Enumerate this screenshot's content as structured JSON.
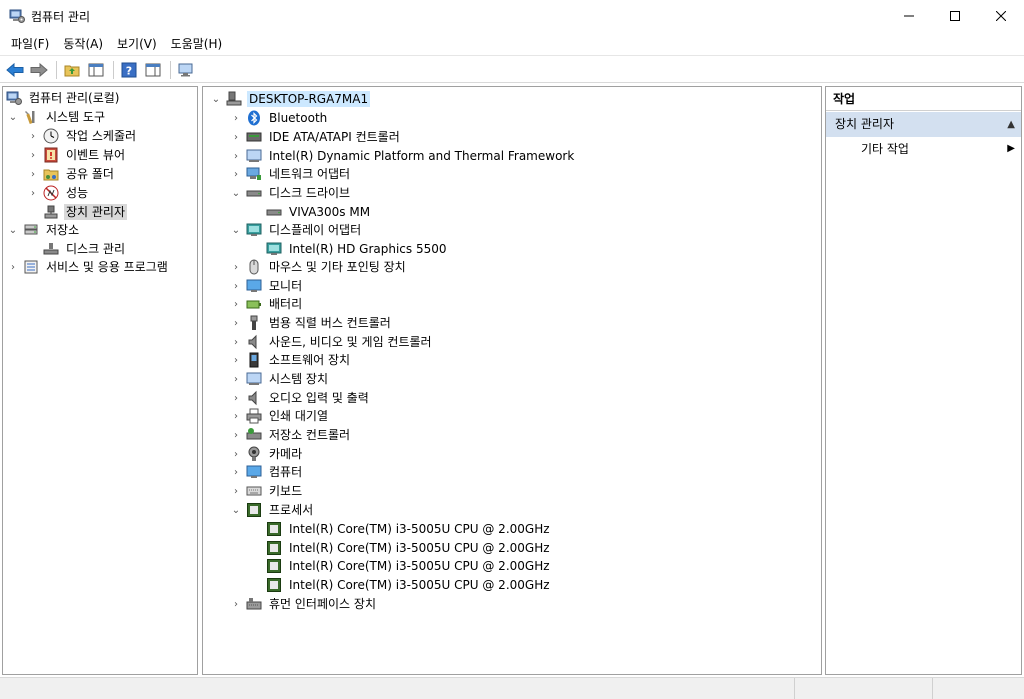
{
  "window": {
    "title": "컴퓨터 관리",
    "icon": "computer-management-icon",
    "controls": [
      "minimize-icon",
      "maximize-icon",
      "close-icon"
    ]
  },
  "menu": [
    "파일(F)",
    "동작(A)",
    "보기(V)",
    "도움말(H)"
  ],
  "toolbar": [
    "back-arrow-icon",
    "forward-arrow-icon",
    "up-folder-icon",
    "show-hide-tree-icon",
    "help-icon",
    "properties-icon",
    "monitor-icon"
  ],
  "left_tree": [
    {
      "label": "컴퓨터 관리(로컬)",
      "icon": "computer-management-icon",
      "expander": "none"
    },
    {
      "label": "시스템 도구",
      "icon": "tools-icon",
      "expander": "expanded"
    },
    {
      "label": "작업 스케줄러",
      "icon": "clock-icon",
      "expander": "collapsed"
    },
    {
      "label": "이벤트 뷰어",
      "icon": "event-viewer-icon",
      "expander": "collapsed"
    },
    {
      "label": "공유 폴더",
      "icon": "shared-folder-icon",
      "expander": "collapsed"
    },
    {
      "label": "성능",
      "icon": "performance-icon",
      "expander": "collapsed"
    },
    {
      "label": "장치 관리자",
      "icon": "device-manager-icon",
      "expander": "none"
    },
    {
      "label": "저장소",
      "icon": "storage-icon",
      "expander": "expanded"
    },
    {
      "label": "디스크 관리",
      "icon": "disk-management-icon",
      "expander": "none"
    },
    {
      "label": "서비스 및 응용 프로그램",
      "icon": "services-icon",
      "expander": "collapsed"
    }
  ],
  "device_tree": [
    {
      "label": "DESKTOP-RGA7MA1",
      "icon": "computer-icon",
      "expander": "expanded"
    },
    {
      "label": "Bluetooth",
      "icon": "bluetooth-icon",
      "expander": "collapsed"
    },
    {
      "label": "IDE ATA/ATAPI 컨트롤러",
      "icon": "ide-controller-icon",
      "expander": "collapsed"
    },
    {
      "label": "Intel(R) Dynamic Platform and Thermal Framework",
      "icon": "system-device-icon",
      "expander": "collapsed"
    },
    {
      "label": "네트워크 어댑터",
      "icon": "network-adapter-icon",
      "expander": "collapsed"
    },
    {
      "label": "디스크 드라이브",
      "icon": "disk-drive-icon",
      "expander": "expanded"
    },
    {
      "label": "VIVA300s MM",
      "icon": "disk-drive-icon",
      "expander": "none"
    },
    {
      "label": "디스플레이 어댑터",
      "icon": "display-adapter-icon",
      "expander": "expanded"
    },
    {
      "label": "Intel(R) HD Graphics 5500",
      "icon": "display-adapter-icon",
      "expander": "none"
    },
    {
      "label": "마우스 및 기타 포인팅 장치",
      "icon": "mouse-icon",
      "expander": "collapsed"
    },
    {
      "label": "모니터",
      "icon": "monitor-icon",
      "expander": "collapsed"
    },
    {
      "label": "배터리",
      "icon": "battery-icon",
      "expander": "collapsed"
    },
    {
      "label": "범용 직렬 버스 컨트롤러",
      "icon": "usb-icon",
      "expander": "collapsed"
    },
    {
      "label": "사운드, 비디오 및 게임 컨트롤러",
      "icon": "speaker-icon",
      "expander": "collapsed"
    },
    {
      "label": "소프트웨어 장치",
      "icon": "software-device-icon",
      "expander": "collapsed"
    },
    {
      "label": "시스템 장치",
      "icon": "system-device-icon",
      "expander": "collapsed"
    },
    {
      "label": "오디오 입력 및 출력",
      "icon": "speaker-icon",
      "expander": "collapsed"
    },
    {
      "label": "인쇄 대기열",
      "icon": "printer-icon",
      "expander": "collapsed"
    },
    {
      "label": "저장소 컨트롤러",
      "icon": "storage-controller-icon",
      "expander": "collapsed"
    },
    {
      "label": "카메라",
      "icon": "camera-icon",
      "expander": "collapsed"
    },
    {
      "label": "컴퓨터",
      "icon": "monitor-icon",
      "expander": "collapsed"
    },
    {
      "label": "키보드",
      "icon": "keyboard-icon",
      "expander": "collapsed"
    },
    {
      "label": "프로세서",
      "icon": "processor-icon",
      "expander": "expanded"
    },
    {
      "label": "Intel(R) Core(TM) i3-5005U CPU @ 2.00GHz",
      "icon": "processor-icon",
      "expander": "none"
    },
    {
      "label": "Intel(R) Core(TM) i3-5005U CPU @ 2.00GHz",
      "icon": "processor-icon",
      "expander": "none"
    },
    {
      "label": "Intel(R) Core(TM) i3-5005U CPU @ 2.00GHz",
      "icon": "processor-icon",
      "expander": "none"
    },
    {
      "label": "Intel(R) Core(TM) i3-5005U CPU @ 2.00GHz",
      "icon": "processor-icon",
      "expander": "none"
    },
    {
      "label": "휴먼 인터페이스 장치",
      "icon": "hid-icon",
      "expander": "collapsed"
    }
  ],
  "actions": {
    "header": "작업",
    "section": "장치 관리자",
    "items": [
      "기타 작업"
    ]
  },
  "colors": {
    "selection_gray": "#d9d9d9",
    "selection_blue": "#cce8ff",
    "action_section": "#d3e0f0",
    "statusbar": "#f0f0f0"
  }
}
